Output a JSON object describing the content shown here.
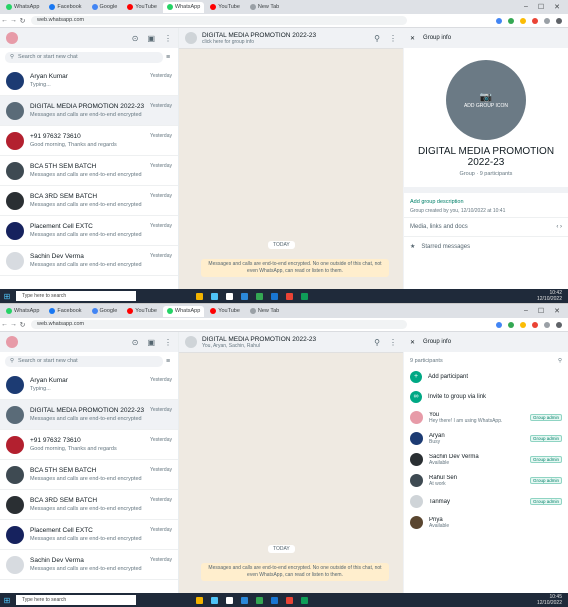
{
  "browser": {
    "tabs": [
      {
        "label": "WhatsApp",
        "color": "#25d366"
      },
      {
        "label": "Facebook",
        "color": "#1877f2"
      },
      {
        "label": "Google",
        "color": "#4285f4"
      },
      {
        "label": "YouTube",
        "color": "#ff0000"
      },
      {
        "label": "WhatsApp",
        "color": "#25d366",
        "active": true
      },
      {
        "label": "YouTube",
        "color": "#ff0000"
      },
      {
        "label": "New Tab",
        "color": "#9aa0a6"
      }
    ],
    "url": "web.whatsapp.com"
  },
  "panels": [
    {
      "search_placeholder": "Search or start new chat",
      "chats": [
        {
          "name": "Aryan Kumar",
          "time": "Yesterday",
          "preview": "Typing...",
          "color": "#1c3b73"
        },
        {
          "name": "DIGITAL MEDIA PROMOTION 2022-23",
          "time": "Yesterday",
          "preview": "Messages and calls are end-to-end encrypted",
          "color": "#5a6b78",
          "selected": true
        },
        {
          "name": "+91 97632 73610",
          "time": "Yesterday",
          "preview": "Good morning, Thanks and regards",
          "color": "#b3202f"
        },
        {
          "name": "BCA 5TH SEM BATCH",
          "time": "Yesterday",
          "preview": "Messages and calls are end-to-end encrypted",
          "color": "#3e4a52"
        },
        {
          "name": "BCA 3RD SEM BATCH",
          "time": "Yesterday",
          "preview": "Messages and calls are end-to-end encrypted",
          "color": "#2a2f33"
        },
        {
          "name": "Placement Cell EXTC",
          "time": "Yesterday",
          "preview": "Messages and calls are end-to-end encrypted",
          "color": "#16225e"
        },
        {
          "name": "Sachin Dev Verma",
          "time": "Yesterday",
          "preview": "Messages and calls are end-to-end encrypted",
          "color": "#d7dbe0"
        }
      ],
      "header": {
        "name": "DIGITAL MEDIA PROMOTION 2022-23",
        "sub": "click here for group info"
      },
      "date_chip": "TODAY",
      "system_message": "Messages and calls are end-to-end encrypted. No one outside of this chat, not even WhatsApp, can read or listen to them.",
      "compose_placeholder": "Type a message",
      "right": {
        "title": "Group info",
        "add_icon_label": "ADD GROUP ICON",
        "group_name": "DIGITAL MEDIA PROMOTION 2022-23",
        "group_type": "Group · 9 participants",
        "add_description": "Add group description",
        "created": "Group created by you, 12/10/2022 at 10:41",
        "media": "Media, links and docs",
        "starred": "Starred messages"
      },
      "taskbar": {
        "search": "Type here to search",
        "time": "10:42",
        "date": "12/10/2022"
      }
    },
    {
      "search_placeholder": "Search or start new chat",
      "chats": [
        {
          "name": "Aryan Kumar",
          "time": "Yesterday",
          "preview": "Typing...",
          "color": "#1c3b73"
        },
        {
          "name": "DIGITAL MEDIA PROMOTION 2022-23",
          "time": "Yesterday",
          "preview": "Messages and calls are end-to-end encrypted",
          "color": "#5a6b78",
          "selected": true
        },
        {
          "name": "+91 97632 73610",
          "time": "Yesterday",
          "preview": "Good morning, Thanks and regards",
          "color": "#b3202f"
        },
        {
          "name": "BCA 5TH SEM BATCH",
          "time": "Yesterday",
          "preview": "Messages and calls are end-to-end encrypted",
          "color": "#3e4a52"
        },
        {
          "name": "BCA 3RD SEM BATCH",
          "time": "Yesterday",
          "preview": "Messages and calls are end-to-end encrypted",
          "color": "#2a2f33"
        },
        {
          "name": "Placement Cell EXTC",
          "time": "Yesterday",
          "preview": "Messages and calls are end-to-end encrypted",
          "color": "#16225e"
        },
        {
          "name": "Sachin Dev Verma",
          "time": "Yesterday",
          "preview": "Messages and calls are end-to-end encrypted",
          "color": "#d7dbe0"
        }
      ],
      "header": {
        "name": "DIGITAL MEDIA PROMOTION 2022-23",
        "sub": "You, Aryan, Sachin, Rahul"
      },
      "date_chip": "TODAY",
      "system_message": "Messages and calls are end-to-end encrypted. No one outside of this chat, not even WhatsApp, can read or listen to them.",
      "compose_placeholder": "Type a message",
      "right": {
        "title": "Group info",
        "participants_label": "9 participants",
        "actions": [
          "Add participant",
          "Invite to group via link"
        ],
        "participants": [
          {
            "name": "You",
            "status": "Hey there! I am using WhatsApp.",
            "badge": "Group admin",
            "color": "#e79ba8"
          },
          {
            "name": "Aryan",
            "status": "Busy",
            "badge": "Group admin",
            "color": "#1c3b73"
          },
          {
            "name": "Sachin Dev Verma",
            "status": "Available",
            "badge": "Group admin",
            "color": "#2a2f33"
          },
          {
            "name": "Rahul Sen",
            "status": "At work",
            "badge": "Group admin",
            "color": "#3e4a52"
          },
          {
            "name": "Tanmay",
            "status": "",
            "badge": "Group admin",
            "color": "#cfd4d8"
          },
          {
            "name": "Priya",
            "status": "Available",
            "badge": "",
            "color": "#5a4630"
          }
        ]
      },
      "taskbar": {
        "search": "Type here to search",
        "time": "10:45",
        "date": "12/10/2022"
      }
    }
  ]
}
